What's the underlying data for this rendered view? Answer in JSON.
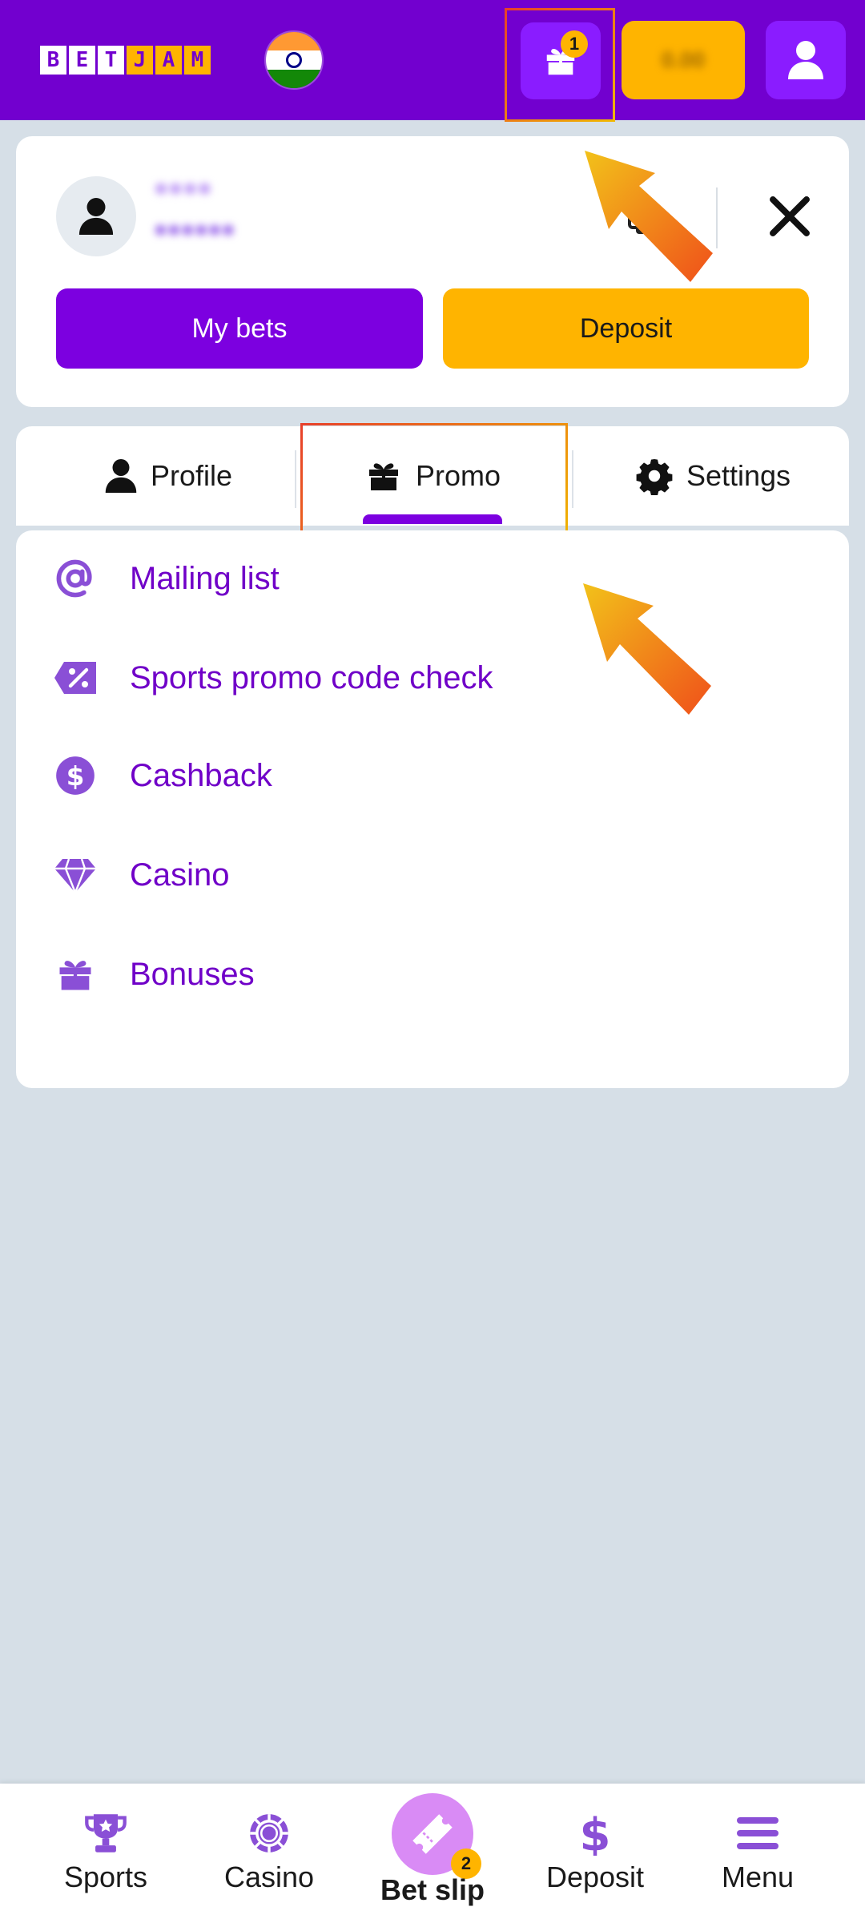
{
  "header": {
    "logo_letters": [
      "B",
      "E",
      "T",
      "J",
      "A",
      "M"
    ],
    "flag": "india-flag",
    "gift_badge": "1",
    "balance_label": "0.00"
  },
  "account": {
    "name": "●●●●",
    "id": "●●●●●●",
    "my_bets_label": "My bets",
    "deposit_label": "Deposit"
  },
  "tabs": [
    {
      "label": "Profile",
      "icon": "user-icon"
    },
    {
      "label": "Promo",
      "icon": "gift-icon",
      "active": true
    },
    {
      "label": "Settings",
      "icon": "gear-icon"
    }
  ],
  "promo_items": [
    {
      "label": "Mailing list",
      "icon": "at-icon"
    },
    {
      "label": "Sports promo code check",
      "icon": "percent-tag-icon"
    },
    {
      "label": "Cashback",
      "icon": "dollar-coin-icon"
    },
    {
      "label": "Casino",
      "icon": "diamond-icon"
    },
    {
      "label": "Bonuses",
      "icon": "gift-icon"
    }
  ],
  "bottom_nav": [
    {
      "label": "Sports",
      "icon": "trophy-icon"
    },
    {
      "label": "Casino",
      "icon": "chip-icon"
    },
    {
      "label": "Bet slip",
      "icon": "ticket-icon",
      "badge": "2"
    },
    {
      "label": "Deposit",
      "icon": "dollar-icon"
    },
    {
      "label": "Menu",
      "icon": "hamburger-icon"
    }
  ],
  "colors": {
    "brand_purple": "#7200cf",
    "accent_yellow": "#ffb400",
    "link_purple": "#7000c8",
    "background": "#d6dfe7"
  }
}
